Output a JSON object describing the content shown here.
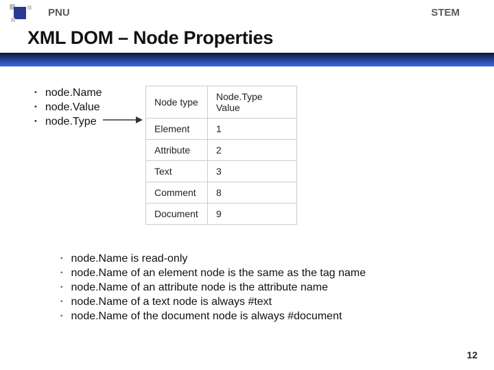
{
  "header": {
    "left": "PNU",
    "right": "STEM"
  },
  "title": "XML DOM – Node Properties",
  "properties": [
    "node.Name",
    "node.Value",
    "node.Type"
  ],
  "table": {
    "headers": [
      "Node type",
      "Node.Type Value"
    ],
    "rows": [
      [
        "Element",
        "1"
      ],
      [
        "Attribute",
        "2"
      ],
      [
        "Text",
        "3"
      ],
      [
        "Comment",
        "8"
      ],
      [
        "Document",
        "9"
      ]
    ]
  },
  "notes": [
    "node.Name is read-only",
    "node.Name of an element node is the same as the tag name",
    "node.Name of an attribute node is the attribute name",
    "node.Name of a text node is always #text",
    "node.Name of the document node is always #document"
  ],
  "page_number": "12"
}
